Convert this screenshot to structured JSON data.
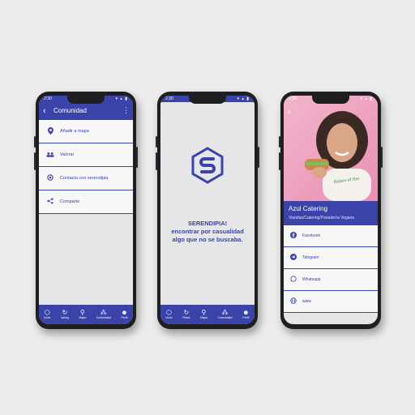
{
  "colors": {
    "accent": "#3a43a8",
    "background": "#ececec",
    "phone": "#1f1f22",
    "screen": "#e6e6e8"
  },
  "phone1": {
    "status_time": "2:30",
    "title": "Comunidad",
    "menu": [
      {
        "label": "Añadir a mapa",
        "icon": "map-pin-icon"
      },
      {
        "label": "Valorar",
        "icon": "people-icon"
      },
      {
        "label": "Contacta con serendipia",
        "icon": "settings-icon"
      },
      {
        "label": "Comparte",
        "icon": "share-icon"
      }
    ],
    "nav": [
      {
        "label": "Inicio",
        "icon": "home-logo-icon"
      },
      {
        "label": "Valorg",
        "icon": "refresh-icon"
      },
      {
        "label": "Mapa",
        "icon": "map-pin-icon"
      },
      {
        "label": "Comunidad",
        "icon": "community-icon"
      },
      {
        "label": "Perfil",
        "icon": "person-icon"
      }
    ]
  },
  "phone2": {
    "status_time": "2:30",
    "tagline": [
      "SERENDIPIA!",
      "encontrar por casualidad",
      "algo que no se buscaba."
    ],
    "nav": [
      {
        "label": "Inicio",
        "icon": "home-logo-icon"
      },
      {
        "label": "Retos",
        "icon": "refresh-icon"
      },
      {
        "label": "Mapa",
        "icon": "map-pin-icon"
      },
      {
        "label": "Comunidad",
        "icon": "community-icon"
      },
      {
        "label": "Perfil",
        "icon": "person-icon"
      }
    ]
  },
  "phone3": {
    "status_time": "2:30",
    "name": "Azul Catering",
    "subtitle": "Viandas/Catering/Panadería Vegana",
    "links": [
      {
        "label": "Facebook",
        "icon": "facebook-icon"
      },
      {
        "label": "Telegram",
        "icon": "telegram-icon"
      },
      {
        "label": "Whatsapp",
        "icon": "whatsapp-icon"
      },
      {
        "label": "www",
        "icon": "globe-icon"
      }
    ]
  }
}
